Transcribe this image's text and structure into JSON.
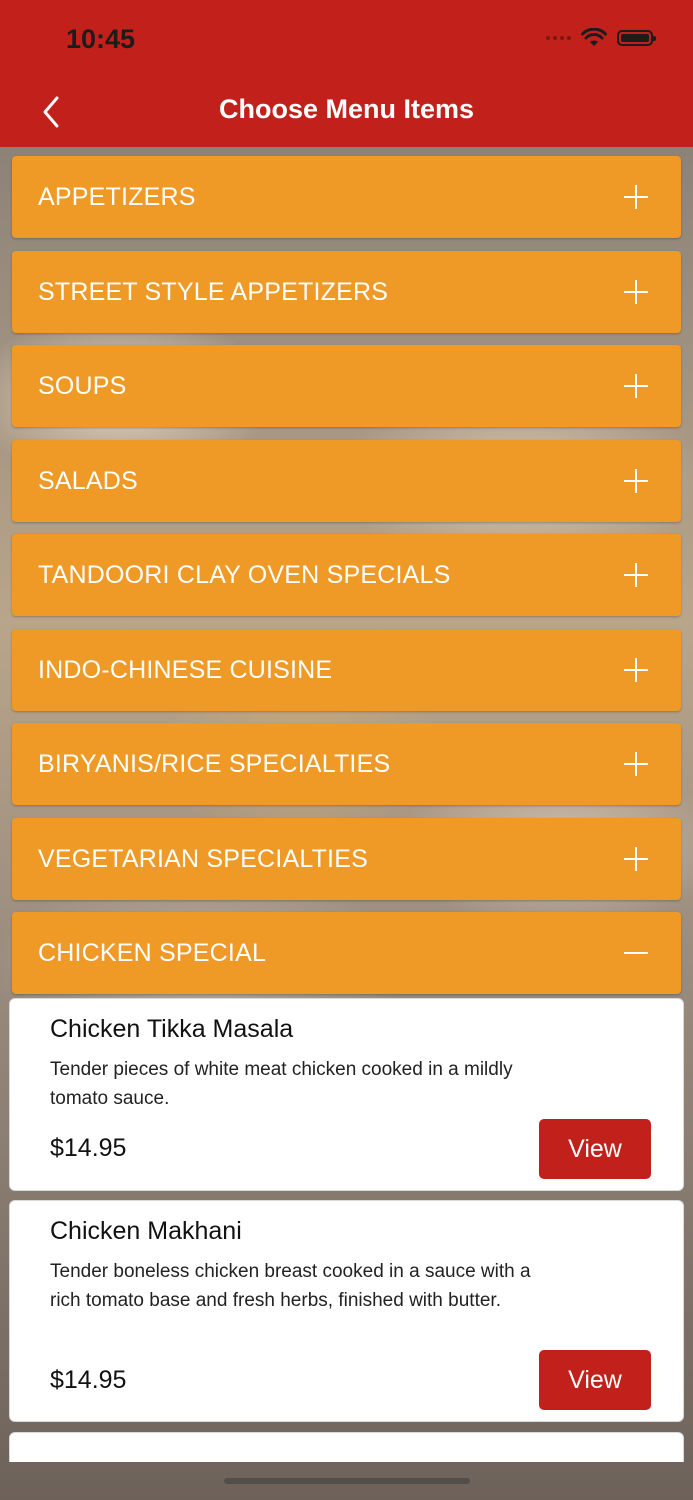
{
  "status_bar": {
    "time": "10:45"
  },
  "header": {
    "title": "Choose Menu Items"
  },
  "categories": [
    {
      "label": "APPETIZERS",
      "icon": "plus-icon"
    },
    {
      "label": "STREET STYLE APPETIZERS",
      "icon": "plus-icon"
    },
    {
      "label": "SOUPS",
      "icon": "plus-icon"
    },
    {
      "label": "SALADS",
      "icon": "plus-icon"
    },
    {
      "label": "TANDOORI CLAY OVEN SPECIALS",
      "icon": "plus-icon"
    },
    {
      "label": "INDO-CHINESE CUISINE",
      "icon": "plus-icon"
    },
    {
      "label": "BIRYANIS/RICE SPECIALTIES",
      "icon": "plus-icon"
    },
    {
      "label": "VEGETARIAN SPECIALTIES",
      "icon": "plus-icon"
    },
    {
      "label": "CHICKEN SPECIAL",
      "icon": "minus-icon"
    }
  ],
  "items": [
    {
      "name": "Chicken Tikka Masala",
      "description": "Tender pieces of white meat chicken cooked in a mildly tomato sauce.",
      "price": "$14.95",
      "button": "View"
    },
    {
      "name": "Chicken Makhani",
      "description": "Tender boneless chicken breast cooked in a sauce with a rich tomato base and fresh herbs, finished with butter.",
      "price": "$14.95",
      "button": "View"
    }
  ],
  "colors": {
    "header": "#c1211a",
    "category": "#ef9a26",
    "button": "#c1211a"
  }
}
